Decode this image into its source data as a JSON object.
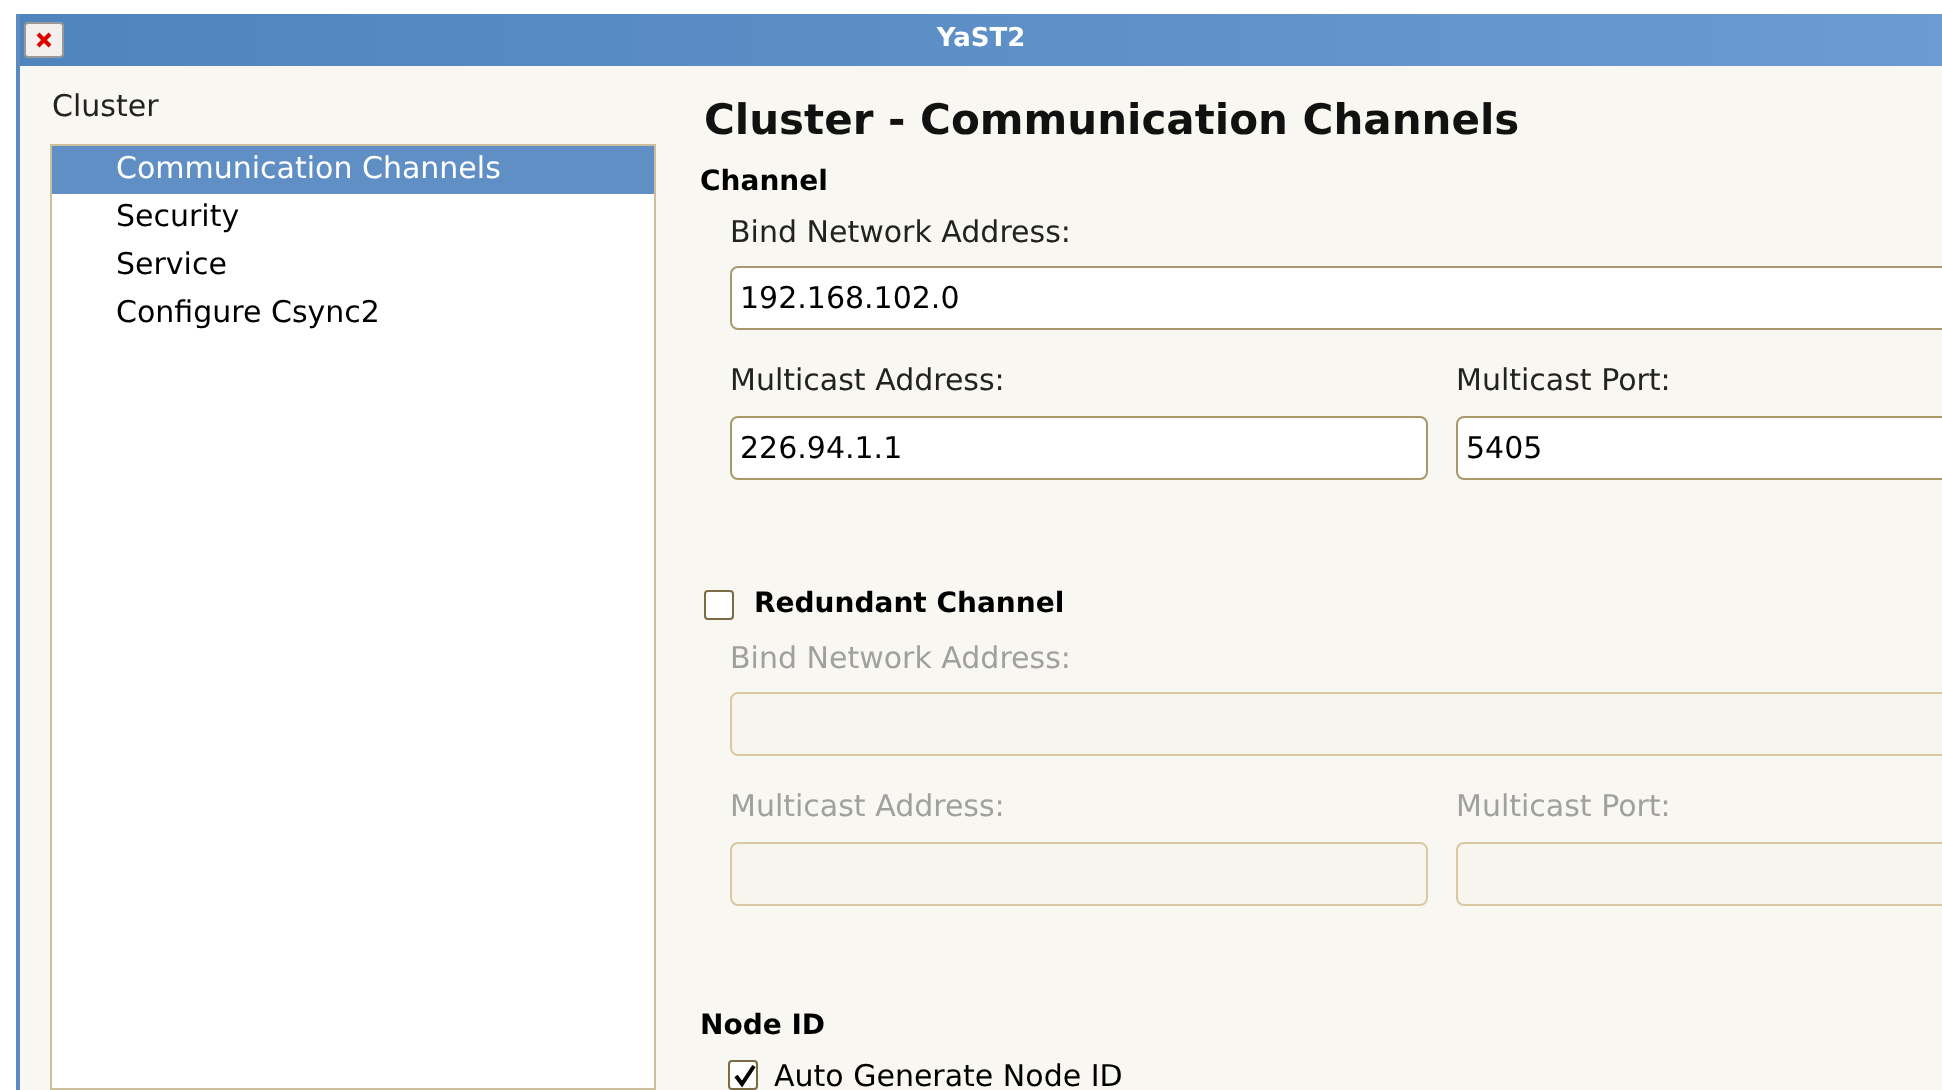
{
  "window": {
    "title": "YaST2"
  },
  "sidebar": {
    "heading": "Cluster",
    "items": [
      {
        "label": "Communication Channels",
        "selected": true
      },
      {
        "label": "Security",
        "selected": false
      },
      {
        "label": "Service",
        "selected": false
      },
      {
        "label": "Configure Csync2",
        "selected": false
      }
    ]
  },
  "page_title": "Cluster - Communication Channels",
  "channel": {
    "heading": "Channel",
    "disabled": false,
    "bind_label": "Bind Network Address:",
    "bind_value": "192.168.102.0",
    "mcast_label": "Multicast Address:",
    "mcast_value": "226.94.1.1",
    "port_label": "Multicast Port:",
    "port_value": "5405"
  },
  "redundant": {
    "label": "Redundant Channel",
    "checked": false,
    "disabled": true,
    "bind_label": "Bind Network Address:",
    "mcast_label": "Multicast Address:",
    "port_label": "Multicast Port:"
  },
  "node_id": {
    "heading": "Node ID",
    "auto_label": "Auto Generate Node ID",
    "checked": true
  }
}
